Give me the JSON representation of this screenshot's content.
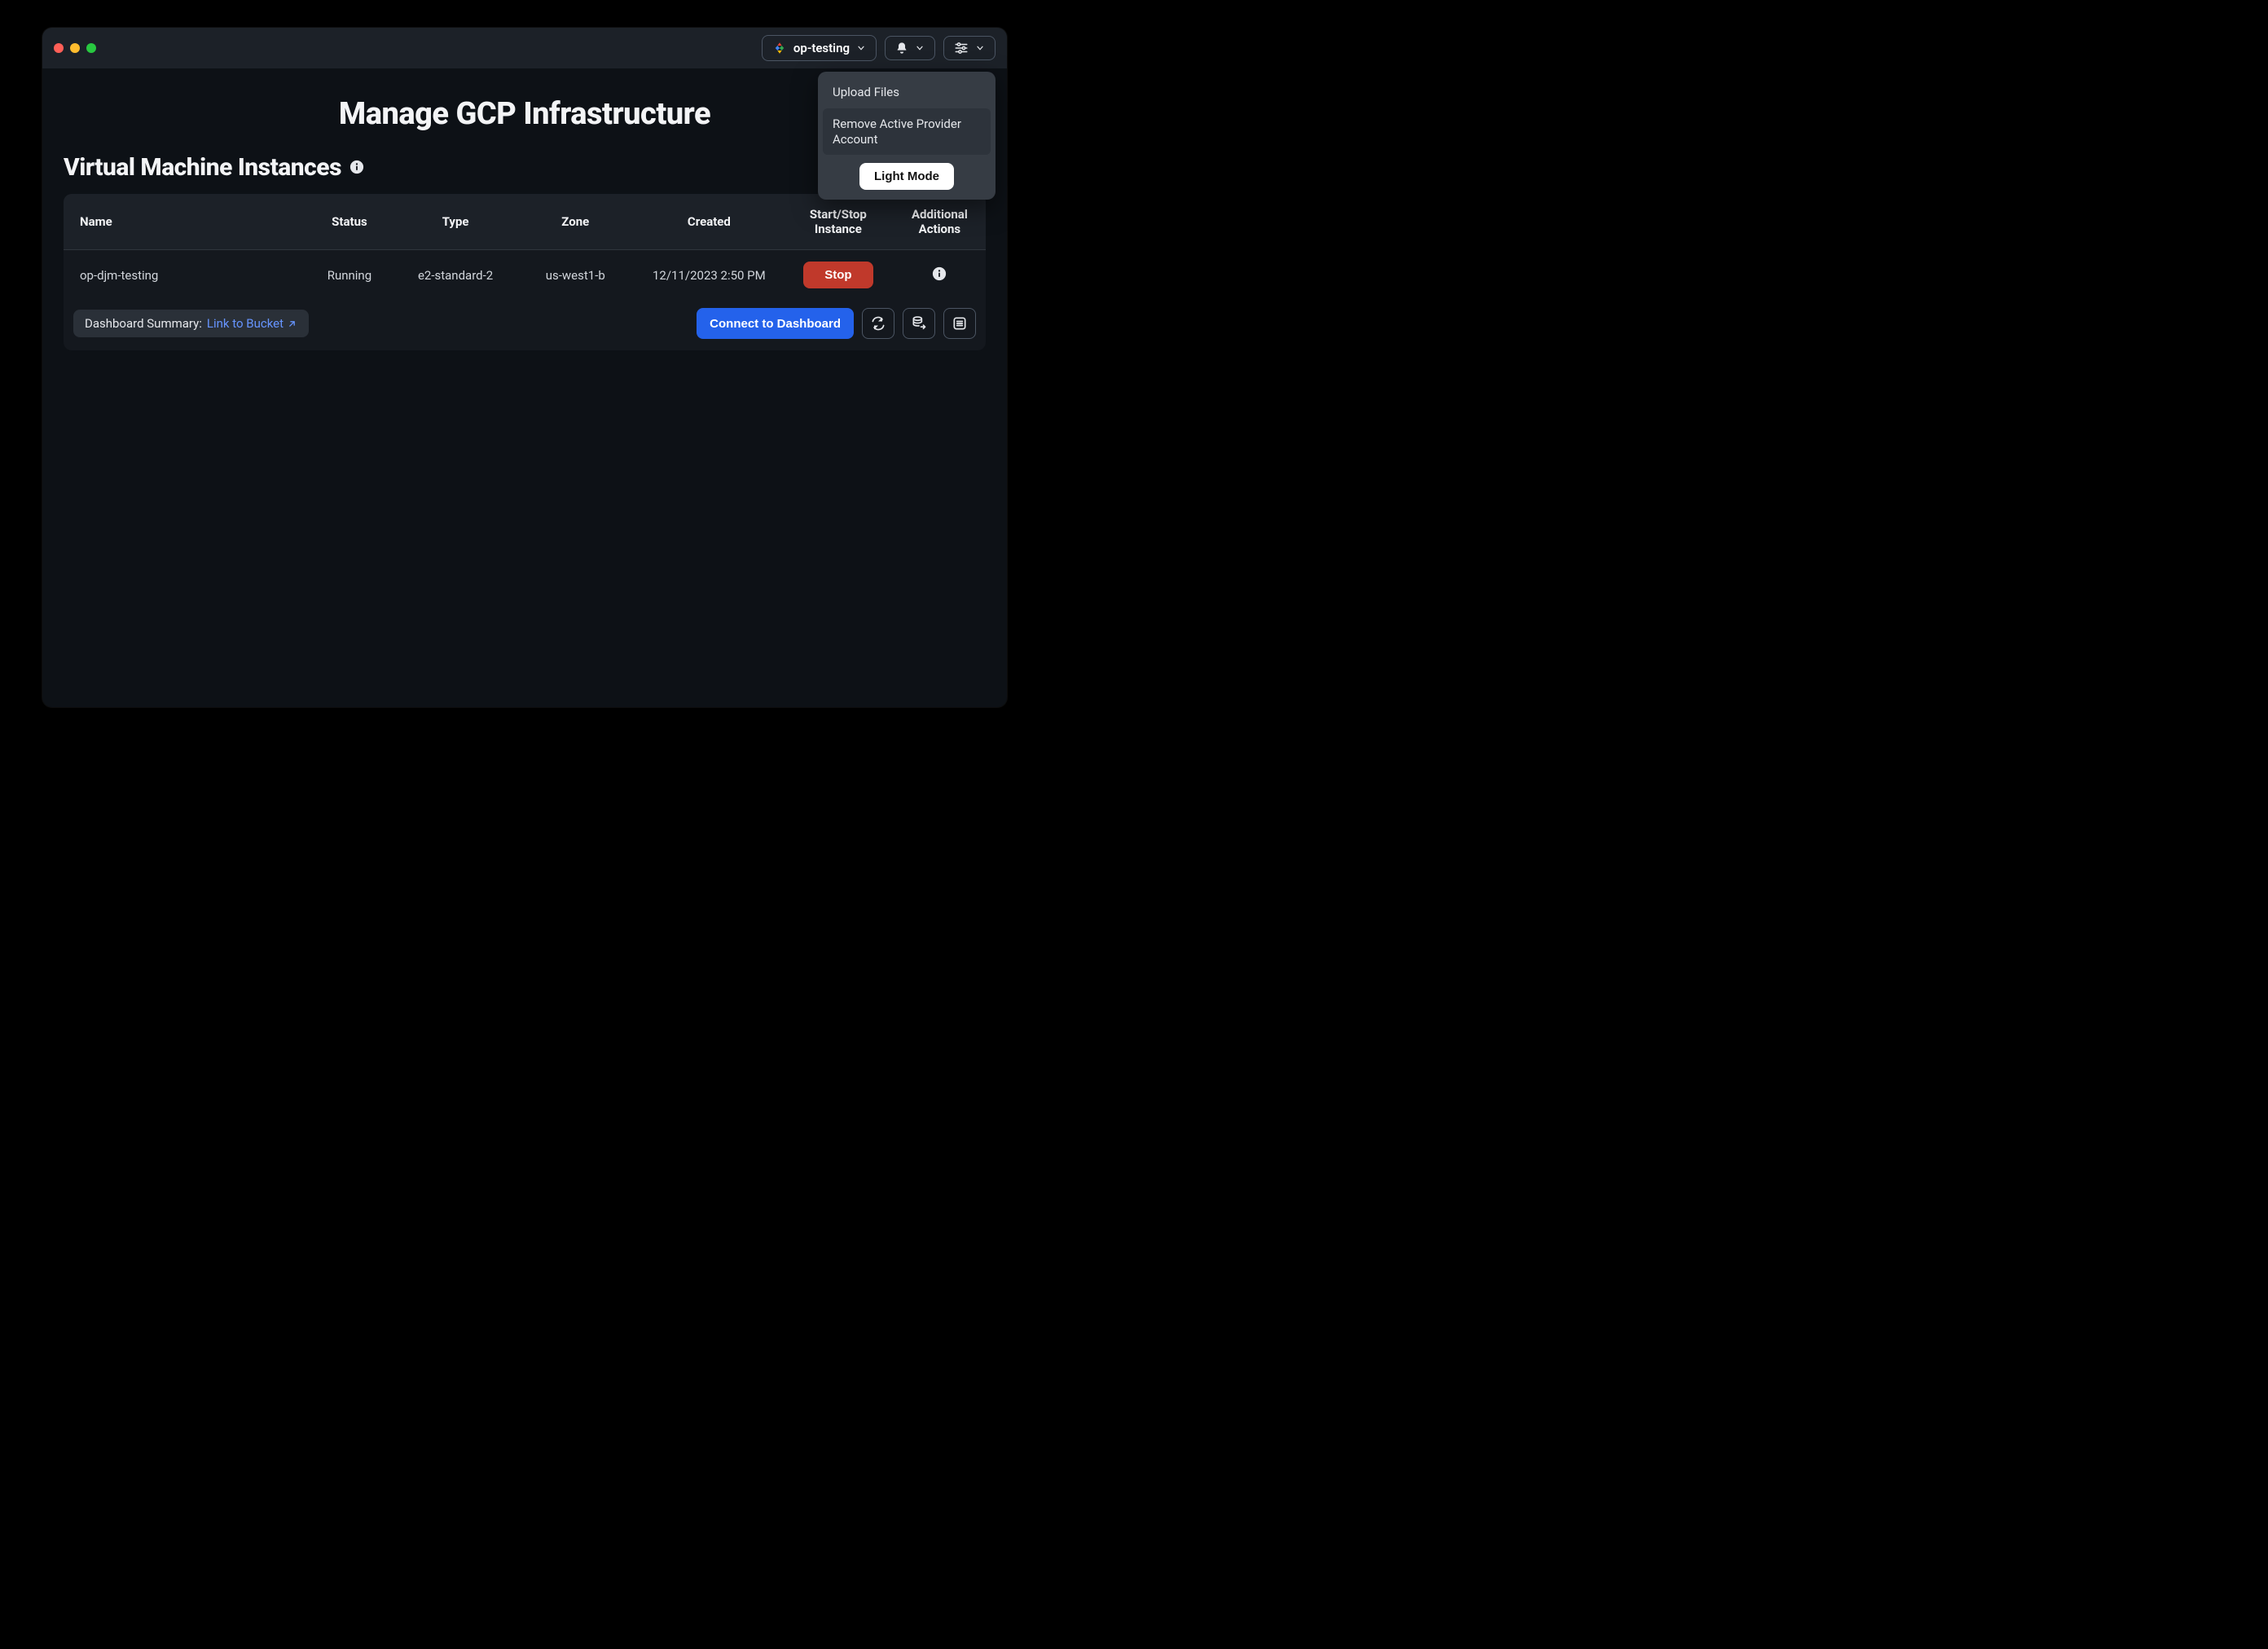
{
  "header": {
    "project_label": "op-testing"
  },
  "dropdown": {
    "upload_label": "Upload Files",
    "remove_label": "Remove Active Provider Account",
    "mode_label": "Light Mode"
  },
  "page": {
    "title": "Manage GCP Infrastructure",
    "section_title": "Virtual Machine Instances",
    "refresh_label": "Refresh List"
  },
  "table": {
    "columns": {
      "name": "Name",
      "status": "Status",
      "type": "Type",
      "zone": "Zone",
      "created": "Created",
      "startstop": "Start/Stop Instance",
      "actions": "Additional Actions"
    },
    "row": {
      "name": "op-djm-testing",
      "status": "Running",
      "type": "e2-standard-2",
      "zone": "us-west1-b",
      "created": "12/11/2023 2:50 PM",
      "stop_label": "Stop"
    }
  },
  "footer": {
    "summary_label": "Dashboard Summary:",
    "bucket_link": "Link to Bucket",
    "connect_label": "Connect to Dashboard"
  }
}
